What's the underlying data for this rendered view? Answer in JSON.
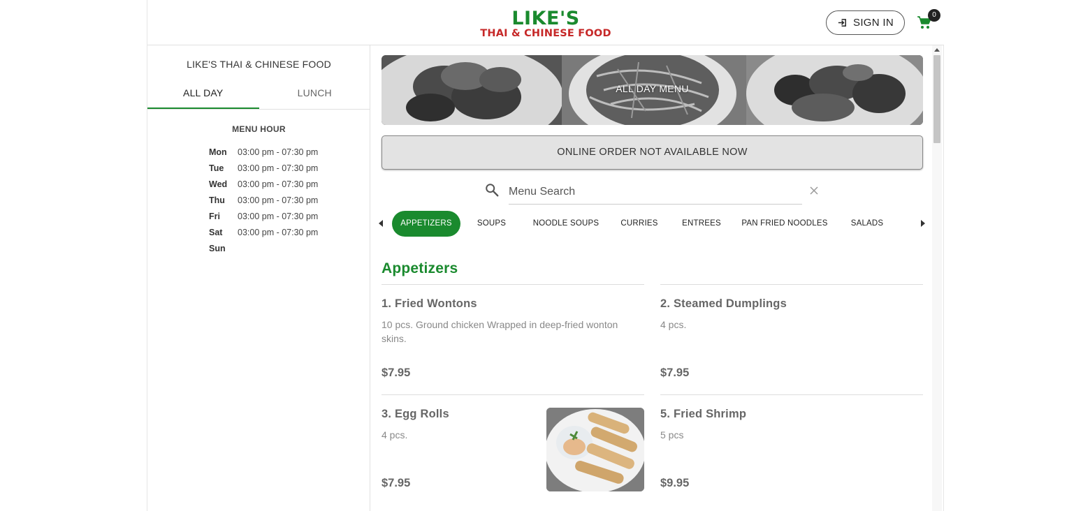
{
  "header": {
    "logo_main": "LIKE'S",
    "logo_sub": "THAI & CHINESE FOOD",
    "sign_in_label": "SIGN IN",
    "cart_count": "0",
    "brand_green": "#1a8a2e",
    "brand_red": "#c62828"
  },
  "sidebar": {
    "restaurant_name": "LIKE'S THAI & CHINESE FOOD",
    "tabs": [
      {
        "label": "ALL DAY",
        "active": true
      },
      {
        "label": "LUNCH",
        "active": false
      }
    ],
    "menu_hour_title": "MENU HOUR",
    "hours": [
      {
        "day": "Mon",
        "time": "03:00 pm - 07:30 pm"
      },
      {
        "day": "Tue",
        "time": "03:00 pm - 07:30 pm"
      },
      {
        "day": "Wed",
        "time": "03:00 pm - 07:30 pm"
      },
      {
        "day": "Thu",
        "time": "03:00 pm - 07:30 pm"
      },
      {
        "day": "Fri",
        "time": "03:00 pm - 07:30 pm"
      },
      {
        "day": "Sat",
        "time": "03:00 pm - 07:30 pm"
      },
      {
        "day": "Sun",
        "time": ""
      }
    ]
  },
  "main": {
    "banner_title": "ALL DAY MENU",
    "order_status": "ONLINE ORDER NOT AVAILABLE NOW",
    "search": {
      "placeholder": "Menu Search",
      "value": ""
    },
    "categories": [
      {
        "label": "APPETIZERS",
        "active": true
      },
      {
        "label": "SOUPS",
        "active": false
      },
      {
        "label": "NOODLE SOUPS",
        "active": false
      },
      {
        "label": "CURRIES",
        "active": false
      },
      {
        "label": "ENTREES",
        "active": false
      },
      {
        "label": "PAN FRIED NOODLES",
        "active": false
      },
      {
        "label": "SALADS",
        "active": false
      }
    ],
    "section_title": "Appetizers",
    "items": [
      {
        "name": "1. Fried Wontons",
        "desc": "10 pcs. Ground chicken Wrapped in deep-fried wonton skins.",
        "price": "$7.95",
        "has_image": false
      },
      {
        "name": "2. Steamed Dumplings",
        "desc": "4 pcs.",
        "price": "$7.95",
        "has_image": false
      },
      {
        "name": "3. Egg Rolls",
        "desc": "4 pcs.",
        "price": "$7.95",
        "has_image": true
      },
      {
        "name": "5. Fried Shrimp",
        "desc": "5 pcs",
        "price": "$9.95",
        "has_image": false
      }
    ]
  },
  "icons": {
    "sign_in": "login-icon",
    "cart": "shopping-cart-icon",
    "search": "search-icon",
    "clear": "close-icon"
  }
}
